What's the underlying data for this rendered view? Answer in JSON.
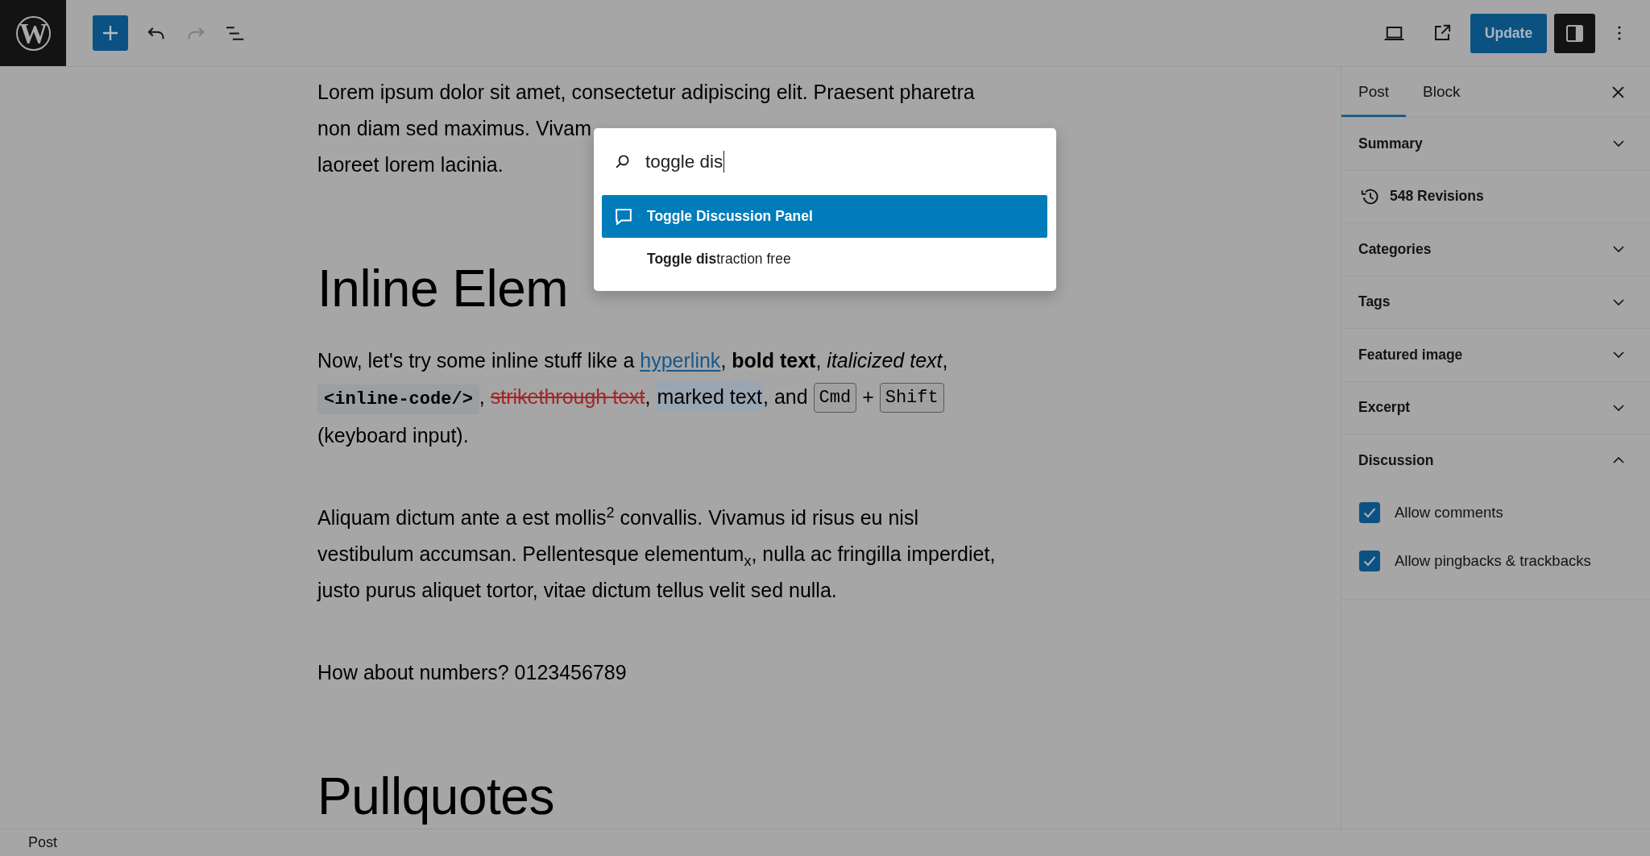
{
  "topbar": {
    "logo": "W",
    "undo": {
      "disabled": false
    },
    "redo": {
      "disabled": true
    },
    "update": "Update",
    "sidebar_toggle": {
      "pressed": true
    }
  },
  "editor": {
    "blocks": [
      {
        "kind": "covered",
        "lines": [
          "Lorem ipsum dolor sit amet, consectetur adipiscing elit. Praesent pharetra",
          "non diam sed maximus. Vivam",
          "laoreet lorem lacinia."
        ]
      },
      {
        "kind": "heading",
        "text": "Inline Elem"
      },
      {
        "kind": "rich",
        "lines": [
          [
            {
              "kind": "text",
              "text": "Now, let's try some inline stuff like a "
            },
            {
              "kind": "link",
              "text": "hyperlink"
            },
            {
              "kind": "text",
              "text": ", **bold text**, *italicized text*,"
            }
          ],
          [
            {
              "kind": "code",
              "text": "<inline-code/>"
            },
            {
              "kind": "text",
              "text": ", "
            },
            {
              "kind": "strike",
              "text": "strikethrough text"
            },
            {
              "kind": "text",
              "text": ", "
            },
            {
              "kind": "mark",
              "text": "marked text"
            },
            {
              "kind": "text",
              "text": ", and "
            },
            {
              "kind": "kbd",
              "text": "Cmd"
            },
            {
              "kind": "text",
              "text": " + "
            },
            {
              "kind": "kbd",
              "text": "Shift"
            }
          ],
          [
            {
              "kind": "text",
              "text": "(keyboard input)."
            }
          ]
        ]
      },
      {
        "kind": "paragraph",
        "lines": [
          "Aliquam dictum ante a est mollis$^{2}$ convallis. Vivamus id risus eu nisl",
          "vestibulum accumsan. Pellentesque elementum$_{x}$, nulla ac fringilla imperdiet,",
          "justo purus aliquet tortor, vitae dictum tellus velit sed nulla."
        ]
      },
      {
        "kind": "paragraph",
        "lines": [
          "How about numbers? 0123456789"
        ]
      },
      {
        "kind": "heading",
        "text": "Pullquotes"
      }
    ]
  },
  "command_palette": {
    "search": {
      "value": "toggle dis",
      "focused": true
    },
    "results": [
      {
        "label": "**Toggle Dis**cussion Panel",
        "has_icon": true,
        "selected": true
      },
      {
        "label": "**Toggle dis**traction free",
        "has_icon": false,
        "selected": false
      }
    ]
  },
  "sidebar": {
    "tabs": [
      {
        "label": "Post",
        "selected": true
      },
      {
        "label": "Block",
        "selected": false
      }
    ],
    "panels": [
      {
        "kind": "panel",
        "title": "Summary",
        "expanded": false
      },
      {
        "kind": "revisions",
        "label": "548 Revisions"
      },
      {
        "kind": "panel",
        "title": "Categories",
        "expanded": false
      },
      {
        "kind": "panel",
        "title": "Tags",
        "expanded": false
      },
      {
        "kind": "panel",
        "title": "Featured image",
        "expanded": false
      },
      {
        "kind": "panel",
        "title": "Excerpt",
        "expanded": false
      },
      {
        "kind": "panel",
        "title": "Discussion",
        "expanded": true,
        "options": [
          {
            "label": "Allow comments",
            "checked": true
          },
          {
            "label": "Allow pingbacks & trackbacks",
            "checked": true
          }
        ]
      }
    ]
  },
  "status_bar": {
    "breadcrumb": "Post"
  }
}
